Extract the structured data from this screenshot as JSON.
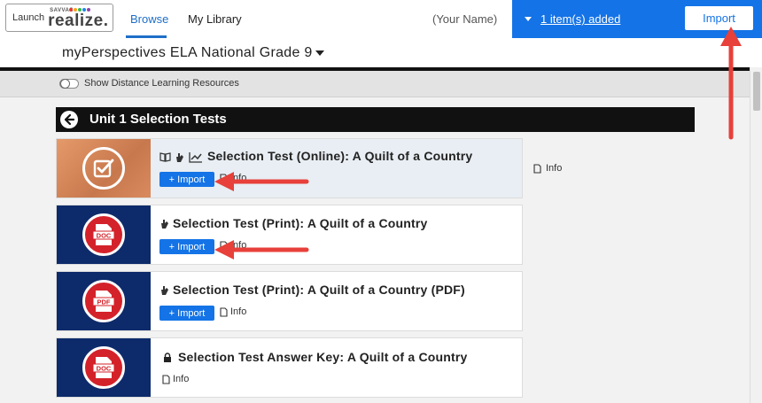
{
  "header": {
    "launch_label": "Launch",
    "brand_small": "SAVVAS",
    "brand_name": "realize.",
    "brand_dot_colors": [
      "#e63b2e",
      "#f6a623",
      "#3cb54a",
      "#1e88e5",
      "#8e44ad"
    ],
    "tabs": [
      {
        "label": "Browse",
        "active": true
      },
      {
        "label": "My Library",
        "active": false
      }
    ],
    "user_name": "(Your Name)",
    "added_link": "1 item(s) added",
    "import_button": "Import",
    "accent_color": "#1473e6"
  },
  "program": {
    "title": "myPerspectives ELA National Grade 9"
  },
  "distance_learning": {
    "label": "Show Distance Learning Resources",
    "enabled": false
  },
  "unit": {
    "title": "Unit 1 Selection Tests"
  },
  "items": [
    {
      "title": "Selection Test (Online): A Quilt of a Country",
      "thumbnail_icon": "checkbox-icon",
      "type_icons": [
        "book-icon",
        "hand-icon",
        "chart-icon"
      ],
      "import_label": "+ Import",
      "info_label": "Info",
      "selected": true
    },
    {
      "title": "Selection Test (Print): A Quilt of a Country",
      "thumbnail_icon": "doc-file-icon",
      "thumbnail_label": "DOC",
      "type_icons": [
        "hand-icon"
      ],
      "import_label": "+ Import",
      "info_label": "Info",
      "selected": false
    },
    {
      "title": "Selection Test (Print): A Quilt of a Country (PDF)",
      "thumbnail_icon": "pdf-file-icon",
      "thumbnail_label": "PDF",
      "type_icons": [
        "hand-icon"
      ],
      "import_label": "+ Import",
      "info_label": "Info",
      "selected": false
    },
    {
      "title": "Selection Test Answer Key: A Quilt of a Country",
      "thumbnail_icon": "doc-file-icon",
      "thumbnail_label": "DOC",
      "type_icons": [
        "lock-icon"
      ],
      "info_label": "Info",
      "selected": false
    }
  ],
  "side_panel": {
    "info_label": "Info"
  },
  "annotation_color": "#e8403a"
}
